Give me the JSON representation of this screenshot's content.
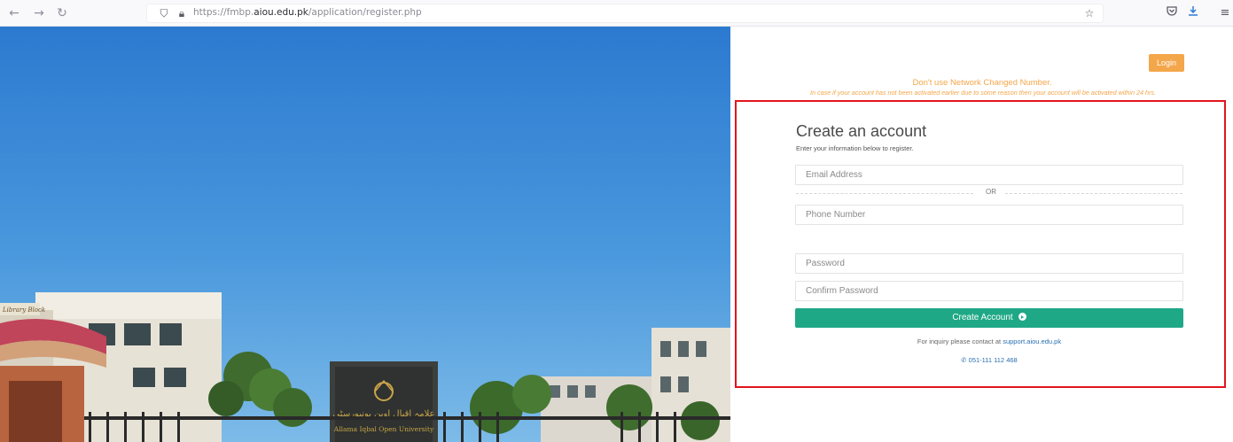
{
  "browser": {
    "back_icon": "arrow-left-icon",
    "forward_icon": "arrow-right-icon",
    "reload_icon": "reload-icon",
    "url_prefix": "https://fmbp.",
    "url_domain": "aiou.edu.pk",
    "url_path": "/application/register.php",
    "right_icons": [
      "star-icon",
      "pocket-icon",
      "download-icon",
      "menu-icon"
    ]
  },
  "hero": {
    "sign_text": "Allama Iqbal Open University",
    "building_sign": "Library Block"
  },
  "header": {
    "login_label": "Login",
    "notice": "Don't use Network Changed Number.",
    "notice_sub": "In case if your account has not been activated earlier due to some reason then your account will be activated within 24 hrs."
  },
  "form": {
    "title": "Create an account",
    "subtitle": "Enter your information below to register.",
    "email_placeholder": "Email Address",
    "or_label": "OR",
    "phone_placeholder": "Phone Number",
    "password_placeholder": "Password",
    "confirm_password_placeholder": "Confirm Password",
    "submit_label": "Create Account"
  },
  "footer": {
    "inquiry_text": "For inquiry please contact at ",
    "support_link": "support.aiou.edu.pk",
    "phone_number": "051-111 112 468"
  },
  "colors": {
    "accent_orange": "#f4a64a",
    "primary_green": "#1fa886",
    "highlight_red": "#e3141b",
    "link_blue": "#2a6fb0"
  }
}
